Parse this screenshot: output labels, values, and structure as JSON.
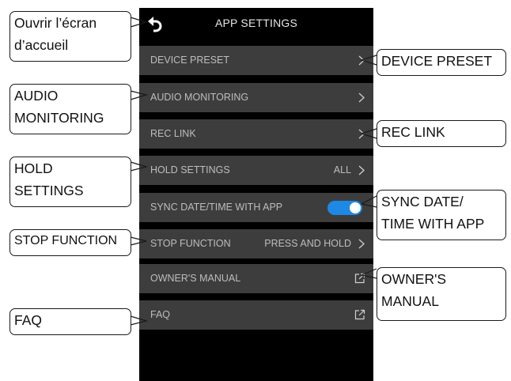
{
  "app": {
    "title": "APP SETTINGS",
    "rows": [
      {
        "label": "DEVICE PRESET",
        "value": "",
        "control": "chevron"
      },
      {
        "label": "AUDIO MONITORING",
        "value": "",
        "control": "chevron"
      },
      {
        "label": "REC LINK",
        "value": "",
        "control": "chevron"
      },
      {
        "label": "HOLD SETTINGS",
        "value": "ALL",
        "control": "chevron"
      },
      {
        "label": "SYNC DATE/TIME WITH APP",
        "value": "",
        "control": "toggle",
        "toggle_on": true
      },
      {
        "label": "STOP FUNCTION",
        "value": "PRESS AND HOLD",
        "control": "chevron"
      },
      {
        "label": "OWNER'S MANUAL",
        "value": "",
        "control": "external-link"
      },
      {
        "label": "FAQ",
        "value": "",
        "control": "external-link"
      }
    ]
  },
  "callouts": {
    "home": [
      "Ouvrir l’écran",
      "d’accueil"
    ],
    "audio_monitoring": [
      "AUDIO",
      "MONITORING"
    ],
    "hold_settings": [
      "HOLD",
      "SETTINGS"
    ],
    "stop_function": [
      "STOP FUNCTION"
    ],
    "faq": [
      "FAQ"
    ],
    "device_preset": [
      "DEVICE PRESET"
    ],
    "rec_link": [
      "REC LINK"
    ],
    "sync_date_time": [
      "SYNC DATE/",
      "TIME WITH APP"
    ],
    "owners_manual": [
      "OWNER'S",
      "MANUAL"
    ]
  },
  "colors": {
    "screen_bg": "#000000",
    "row_bg": "#3d3d3d",
    "row_text": "#bdbdbd",
    "toggle_on": "#1e88e5"
  },
  "icons": {
    "back": "back-arrow-icon",
    "chevron": "chevron-right-icon",
    "external": "external-link-icon"
  }
}
